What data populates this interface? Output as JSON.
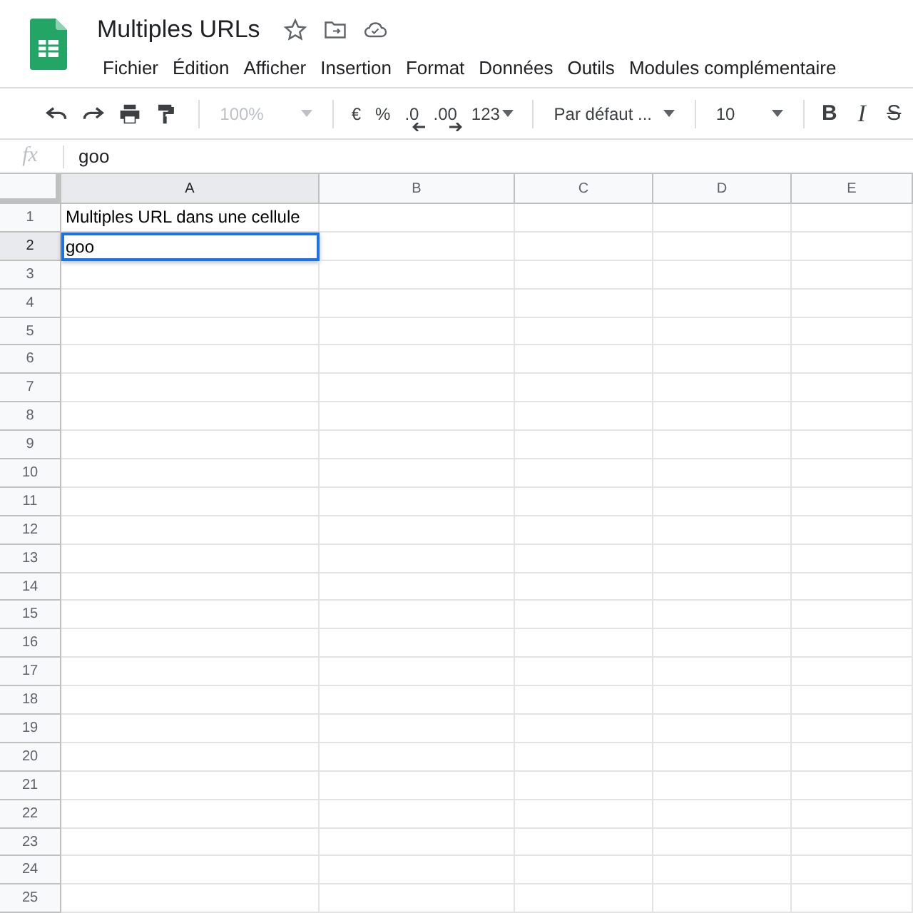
{
  "document": {
    "title": "Multiples URLs"
  },
  "menu": [
    "Fichier",
    "Édition",
    "Afficher",
    "Insertion",
    "Format",
    "Données",
    "Outils",
    "Modules complémentaire"
  ],
  "toolbar": {
    "zoom": {
      "label": "100%",
      "disabled": true
    },
    "number_formats": [
      "€",
      "%",
      ".0",
      ".00",
      "123"
    ],
    "font": "Par défaut ...",
    "font_size": "10",
    "text_styles": [
      "B",
      "I",
      "S"
    ]
  },
  "formula_bar": {
    "label": "fx",
    "value": "goo"
  },
  "columns": [
    "A",
    "B",
    "C",
    "D",
    "E"
  ],
  "rows": [
    {
      "label": "1",
      "cells": [
        {
          "text": "Multiples URL dans une cellule",
          "selected": false
        }
      ]
    },
    {
      "label": "2",
      "cells": [
        {
          "text": "goo",
          "selected": true
        }
      ]
    },
    {
      "label": "3"
    },
    {
      "label": "4"
    },
    {
      "label": "5"
    },
    {
      "label": "6"
    },
    {
      "label": "7"
    },
    {
      "label": "8"
    },
    {
      "label": "9"
    },
    {
      "label": "10"
    },
    {
      "label": "11"
    },
    {
      "label": "12"
    },
    {
      "label": "13"
    },
    {
      "label": "14"
    },
    {
      "label": "15"
    },
    {
      "label": "16"
    },
    {
      "label": "17"
    },
    {
      "label": "18"
    },
    {
      "label": "19"
    },
    {
      "label": "20"
    },
    {
      "label": "21"
    },
    {
      "label": "22"
    },
    {
      "label": "23"
    },
    {
      "label": "24"
    },
    {
      "label": "25"
    }
  ]
}
